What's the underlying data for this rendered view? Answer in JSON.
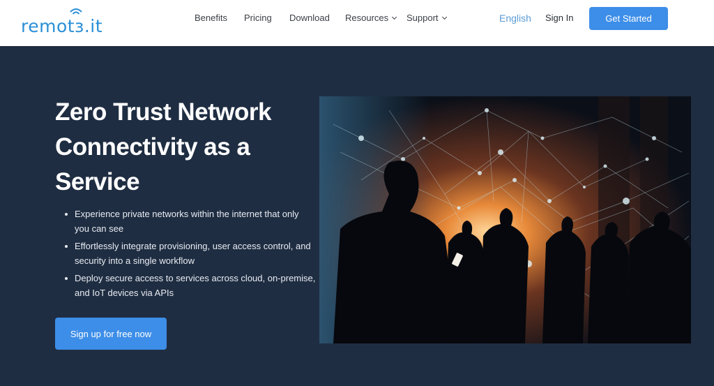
{
  "header": {
    "logo_text": "remotз.it",
    "nav": [
      {
        "label": "Benefits",
        "has_dropdown": false
      },
      {
        "label": "Pricing",
        "has_dropdown": false
      },
      {
        "label": "Download",
        "has_dropdown": false
      },
      {
        "label": "Resources",
        "has_dropdown": true
      },
      {
        "label": "Support",
        "has_dropdown": true
      }
    ],
    "language": "English",
    "sign_in": "Sign In",
    "get_started": "Get Started"
  },
  "hero": {
    "title_lines": [
      "Zero Trust Network",
      "Connectivity as a",
      "Service"
    ],
    "bullets": [
      "Experience  private networks within the internet that only you can see",
      "Effortlessly integrate provisioning, user access control, and security into a single workflow",
      "Deploy secure access to services across cloud, on-premise, and IoT devices via APIs"
    ],
    "cta_label": "Sign up for free now",
    "image_description": "Business people walking through a city street under a glowing network of connected nodes"
  },
  "colors": {
    "brand": "#2b8fd6",
    "button": "#3d8ee8",
    "hero_bg": "#1f2d42"
  }
}
